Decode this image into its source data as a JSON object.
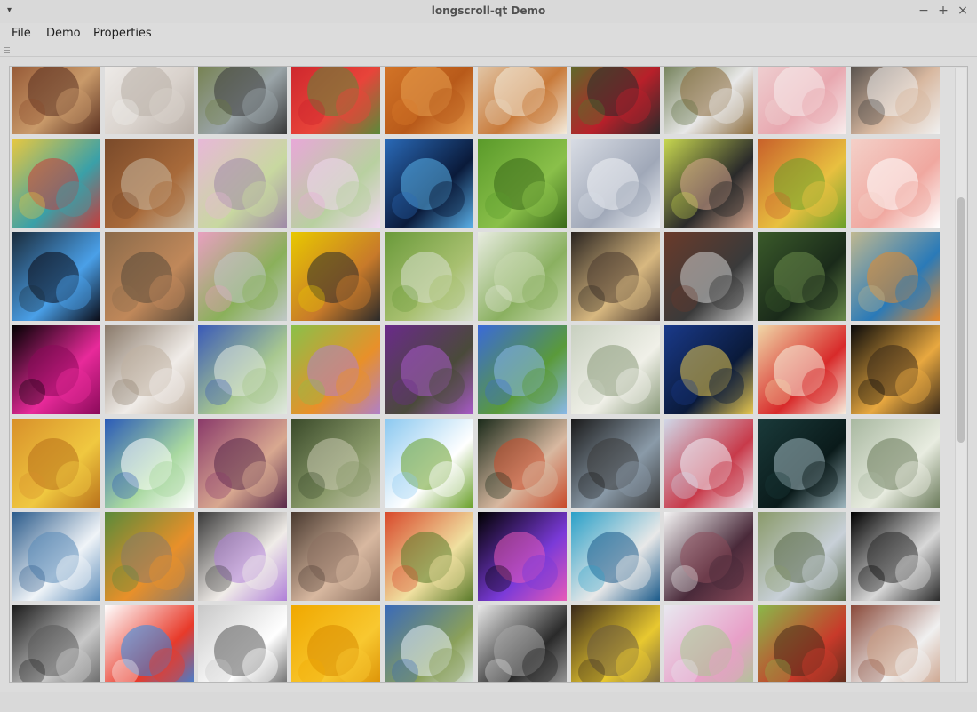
{
  "window": {
    "title": "longscroll-qt Demo",
    "controls": {
      "minimize": "−",
      "maximize": "+",
      "close": "×"
    },
    "menu_glyph": "▾"
  },
  "menubar": {
    "items": [
      "File",
      "Demo",
      "Properties"
    ]
  },
  "gallery": {
    "columns": 10,
    "rows": [
      [
        {
          "name": "horses-sign",
          "c1": "#8a4a2a",
          "c2": "#c99a6a",
          "c3": "#5a3020"
        },
        {
          "name": "white-hamster",
          "c1": "#f2f0ee",
          "c2": "#d9d2cc",
          "c3": "#b8aea6"
        },
        {
          "name": "bird-on-camera",
          "c1": "#6e7a3e",
          "c2": "#9aa4a8",
          "c3": "#3a3a3a"
        },
        {
          "name": "strawberries",
          "c1": "#c8202a",
          "c2": "#e8443a",
          "c3": "#5a8a3a"
        },
        {
          "name": "orange-cat",
          "c1": "#d97a2a",
          "c2": "#b85a1a",
          "c3": "#e8a050"
        },
        {
          "name": "dessert-cups",
          "c1": "#e8d8c0",
          "c2": "#c87a3a",
          "c3": "#f4ecdc"
        },
        {
          "name": "woman-red-skirt",
          "c1": "#4a7a2a",
          "c2": "#b8202a",
          "c3": "#2a2a2a"
        },
        {
          "name": "stork-nest",
          "c1": "#5a6a3a",
          "c2": "#e8e8e8",
          "c3": "#8a6a3a"
        },
        {
          "name": "pink-carnation",
          "c1": "#f0d8d8",
          "c2": "#e8a8b0",
          "c3": "#f8eeee"
        },
        {
          "name": "woman-cards",
          "c1": "#3a3a3a",
          "c2": "#d8b8a0",
          "c3": "#f0f0f0"
        }
      ],
      [
        {
          "name": "retro-woman-tray",
          "c1": "#e8c840",
          "c2": "#3aa0a8",
          "c3": "#c83a3a"
        },
        {
          "name": "funny-horses",
          "c1": "#7a4a2a",
          "c2": "#a86a3a",
          "c3": "#c8b8a0"
        },
        {
          "name": "cherry-blossom-path",
          "c1": "#e8b8d8",
          "c2": "#c8d8a0",
          "c3": "#a08aa8"
        },
        {
          "name": "pink-flowers",
          "c1": "#e8a8d8",
          "c2": "#b8d0a0",
          "c3": "#f0d8f0"
        },
        {
          "name": "blue-fish-art",
          "c1": "#2a6ab8",
          "c2": "#0a1a3a",
          "c3": "#5ab0e8"
        },
        {
          "name": "man-lying-grass",
          "c1": "#5a9a2a",
          "c2": "#8ac04a",
          "c3": "#3a6a1a"
        },
        {
          "name": "snow-mountain",
          "c1": "#d8dce4",
          "c2": "#a0a8b8",
          "c3": "#f0f2f6"
        },
        {
          "name": "woman-hat",
          "c1": "#c8d850",
          "c2": "#2a2a2a",
          "c3": "#d8a890"
        },
        {
          "name": "cornucopia-veggies",
          "c1": "#c8602a",
          "c2": "#e8c040",
          "c3": "#6aa02a"
        },
        {
          "name": "pink-rose",
          "c1": "#f4d0c8",
          "c2": "#f0a8a0",
          "c3": "#ffffff"
        }
      ],
      [
        {
          "name": "glowing-face",
          "c1": "#1a2a3a",
          "c2": "#4aa0e8",
          "c3": "#0a0a14"
        },
        {
          "name": "squirrel-toy",
          "c1": "#8a6a4a",
          "c2": "#c0885a",
          "c3": "#5a4a3a"
        },
        {
          "name": "pink-tulips",
          "c1": "#e8a0c0",
          "c2": "#8ab05a",
          "c3": "#c0c8c8"
        },
        {
          "name": "ladybug",
          "c1": "#e8c800",
          "c2": "#c87a2a",
          "c3": "#2a2a2a"
        },
        {
          "name": "green-hills",
          "c1": "#6a9a3a",
          "c2": "#a8c070",
          "c3": "#d8e0d0"
        },
        {
          "name": "white-roses",
          "c1": "#e8ece0",
          "c2": "#8ab060",
          "c3": "#c8d8b0"
        },
        {
          "name": "blonde-woman",
          "c1": "#2a2420",
          "c2": "#d8b880",
          "c3": "#4a3a30"
        },
        {
          "name": "turntable-laptop",
          "c1": "#6a3a2a",
          "c2": "#3a3a3a",
          "c3": "#d0d0d0"
        },
        {
          "name": "woman-green",
          "c1": "#3a5a2a",
          "c2": "#1a2a1a",
          "c3": "#6a8a4a"
        },
        {
          "name": "kingfisher",
          "c1": "#c0b890",
          "c2": "#2a7ab8",
          "c3": "#e88a2a"
        }
      ],
      [
        {
          "name": "pink-smoke",
          "c1": "#000000",
          "c2": "#e82a9a",
          "c3": "#8a0a5a"
        },
        {
          "name": "book-flowers",
          "c1": "#8a7a6a",
          "c2": "#f0ece8",
          "c3": "#c0b0a0"
        },
        {
          "name": "blue-flower-jar",
          "c1": "#3a5ab8",
          "c2": "#a8c890",
          "c3": "#e0e8e0"
        },
        {
          "name": "butterfly-flower",
          "c1": "#8ac04a",
          "c2": "#e8902a",
          "c3": "#b080c8"
        },
        {
          "name": "purple-crocus",
          "c1": "#6a2a8a",
          "c2": "#4a4a3a",
          "c3": "#a85ac8"
        },
        {
          "name": "cornflowers",
          "c1": "#3a6ad8",
          "c2": "#5a9a3a",
          "c3": "#8ab8e8"
        },
        {
          "name": "frosty-meadow",
          "c1": "#c8d0c0",
          "c2": "#f0f0e8",
          "c3": "#8a9a7a"
        },
        {
          "name": "camera-closeup",
          "c1": "#1a3a8a",
          "c2": "#0a1a3a",
          "c3": "#e8c850"
        },
        {
          "name": "strawberry-cake",
          "c1": "#f0d8a8",
          "c2": "#d82a2a",
          "c3": "#f8f0e0"
        },
        {
          "name": "candles-dark",
          "c1": "#0a0a0a",
          "c2": "#e8a840",
          "c3": "#3a2a1a"
        }
      ],
      [
        {
          "name": "chevron-pattern",
          "c1": "#d8902a",
          "c2": "#f0c840",
          "c3": "#b8701a"
        },
        {
          "name": "woven-pattern",
          "c1": "#2a5ab8",
          "c2": "#a8d8a0",
          "c3": "#ffffff"
        },
        {
          "name": "woman-purple-hair",
          "c1": "#8a3a6a",
          "c2": "#d8a890",
          "c3": "#5a2a4a"
        },
        {
          "name": "misty-valley",
          "c1": "#3a4a2a",
          "c2": "#8a9a6a",
          "c3": "#c8c8b0"
        },
        {
          "name": "white-blossoms-sky",
          "c1": "#8ac8f0",
          "c2": "#ffffff",
          "c3": "#6aa02a"
        },
        {
          "name": "woman-guitar",
          "c1": "#1a2a1a",
          "c2": "#d8b8a0",
          "c3": "#c84a2a"
        },
        {
          "name": "silhouette-window",
          "c1": "#1a1a1a",
          "c2": "#8a9aa8",
          "c3": "#3a3a3a"
        },
        {
          "name": "woman-white-shirt",
          "c1": "#d0d8e8",
          "c2": "#c83a4a",
          "c3": "#f0f0f8"
        },
        {
          "name": "dark-cat",
          "c1": "#1a3a3a",
          "c2": "#0a1a1a",
          "c3": "#a0b8c0"
        },
        {
          "name": "frosty-field",
          "c1": "#a8b8a0",
          "c2": "#e8ece0",
          "c3": "#6a7a5a"
        }
      ],
      [
        {
          "name": "ocean-waves",
          "c1": "#2a5a8a",
          "c2": "#f0f4f8",
          "c3": "#5a8ab8"
        },
        {
          "name": "barbed-wire-drop",
          "c1": "#5a8a3a",
          "c2": "#e8902a",
          "c3": "#8a7a6a"
        },
        {
          "name": "book-violets",
          "c1": "#3a3a3a",
          "c2": "#f0ece8",
          "c3": "#b080d8"
        },
        {
          "name": "woman-sitting",
          "c1": "#4a3a30",
          "c2": "#d8b8a0",
          "c3": "#8a7060"
        },
        {
          "name": "flower-crown",
          "c1": "#d8482a",
          "c2": "#f0e0a0",
          "c3": "#5a7a2a"
        },
        {
          "name": "purple-gerbera",
          "c1": "#000000",
          "c2": "#7a3ad8",
          "c3": "#e85ab8"
        },
        {
          "name": "blue-clocks",
          "c1": "#2aa0c8",
          "c2": "#e8e8e8",
          "c3": "#1a5a8a"
        },
        {
          "name": "figs",
          "c1": "#f4f4f4",
          "c2": "#4a2a3a",
          "c3": "#8a4a5a"
        },
        {
          "name": "mountain-valley",
          "c1": "#8a9a6a",
          "c2": "#c8d0d8",
          "c3": "#5a6a4a"
        },
        {
          "name": "spoon-dark",
          "c1": "#000000",
          "c2": "#d8d8d8",
          "c3": "#2a2a2a"
        }
      ],
      [
        {
          "name": "harp-player",
          "c1": "#1a1a1a",
          "c2": "#c8c8c8",
          "c3": "#5a5a5a"
        },
        {
          "name": "rubiks-cubes",
          "c1": "#ffffff",
          "c2": "#e83a2a",
          "c3": "#2a8ae8"
        },
        {
          "name": "white-doves",
          "c1": "#c8c8c8",
          "c2": "#ffffff",
          "c3": "#5a5a5a"
        },
        {
          "name": "yellow-petal",
          "c1": "#f0a800",
          "c2": "#f8c830",
          "c3": "#d88a00"
        },
        {
          "name": "country-road",
          "c1": "#3a6ab8",
          "c2": "#8aa05a",
          "c3": "#e8f0f8"
        },
        {
          "name": "chess-cup",
          "c1": "#e8e8e8",
          "c2": "#2a2a2a",
          "c3": "#a8a8a8"
        },
        {
          "name": "piano-rose",
          "c1": "#3a2a1a",
          "c2": "#e8c830",
          "c3": "#6a5a40"
        },
        {
          "name": "pink-tulips-light",
          "c1": "#e8e8f0",
          "c2": "#e8a0c8",
          "c3": "#a8c890"
        },
        {
          "name": "peacock-butterfly",
          "c1": "#8ab84a",
          "c2": "#c83a2a",
          "c3": "#4a2a1a"
        },
        {
          "name": "woman-white-top",
          "c1": "#8a4a3a",
          "c2": "#f0f0f0",
          "c3": "#c89a80"
        }
      ]
    ]
  }
}
